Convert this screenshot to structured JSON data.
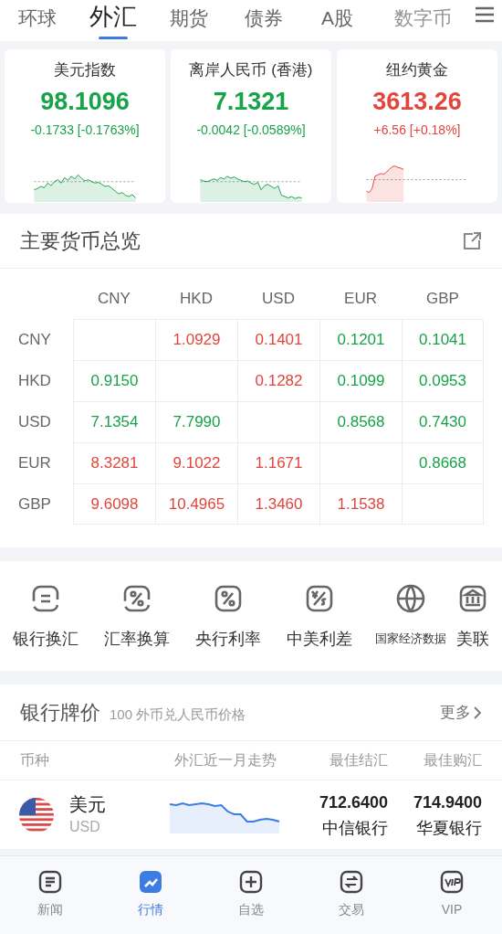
{
  "top_tabs": [
    {
      "label": "环球",
      "selected": false
    },
    {
      "label": "外汇",
      "selected": true
    },
    {
      "label": "期货",
      "selected": false
    },
    {
      "label": "债券",
      "selected": false
    },
    {
      "label": "A股",
      "selected": false
    },
    {
      "label": "数字币",
      "selected": false
    }
  ],
  "quote_cards": [
    {
      "name": "美元指数",
      "price": "98.1096",
      "change": "-0.1733 [-0.1763%]",
      "color": "#17a34a"
    },
    {
      "name": "离岸人民币 (香港)",
      "price": "7.1321",
      "change": "-0.0042 [-0.0589%]",
      "color": "#17a34a"
    },
    {
      "name": "纽约黄金",
      "price": "3613.26",
      "change": "+6.56 [+0.18%]",
      "color": "#e2453c"
    }
  ],
  "overview": {
    "title": "主要货币总览",
    "columns": [
      "CNY",
      "HKD",
      "USD",
      "EUR",
      "GBP"
    ],
    "rows": [
      {
        "label": "CNY",
        "cells": [
          null,
          {
            "value": "1.0929",
            "color": "#e2453c"
          },
          {
            "value": "0.1401",
            "color": "#e2453c"
          },
          {
            "value": "0.1201",
            "color": "#17a34a"
          },
          {
            "value": "0.1041",
            "color": "#17a34a"
          }
        ]
      },
      {
        "label": "HKD",
        "cells": [
          {
            "value": "0.9150",
            "color": "#17a34a"
          },
          null,
          {
            "value": "0.1282",
            "color": "#e2453c"
          },
          {
            "value": "0.1099",
            "color": "#17a34a"
          },
          {
            "value": "0.0953",
            "color": "#17a34a"
          }
        ]
      },
      {
        "label": "USD",
        "cells": [
          {
            "value": "7.1354",
            "color": "#17a34a"
          },
          {
            "value": "7.7990",
            "color": "#17a34a"
          },
          null,
          {
            "value": "0.8568",
            "color": "#17a34a"
          },
          {
            "value": "0.7430",
            "color": "#17a34a"
          }
        ]
      },
      {
        "label": "EUR",
        "cells": [
          {
            "value": "8.3281",
            "color": "#e2453c"
          },
          {
            "value": "9.1022",
            "color": "#e2453c"
          },
          {
            "value": "1.1671",
            "color": "#e2453c"
          },
          null,
          {
            "value": "0.8668",
            "color": "#17a34a"
          }
        ]
      },
      {
        "label": "GBP",
        "cells": [
          {
            "value": "9.6098",
            "color": "#e2453c"
          },
          {
            "value": "10.4965",
            "color": "#e2453c"
          },
          {
            "value": "1.3460",
            "color": "#e2453c"
          },
          {
            "value": "1.1538",
            "color": "#e2453c"
          },
          null
        ]
      }
    ]
  },
  "shortcuts": [
    {
      "label": "银行换汇",
      "kind": "exchange"
    },
    {
      "label": "汇率换算",
      "kind": "percent-cycle"
    },
    {
      "label": "央行利率",
      "kind": "percent"
    },
    {
      "label": "中美利差",
      "kind": "yen-dollar"
    },
    {
      "label": "国家经济数据",
      "kind": "globe"
    },
    {
      "label": "美联",
      "kind": "bank"
    }
  ],
  "bank_prices": {
    "title": "银行牌价",
    "subtitle": "100 外币兑人民币价格",
    "more": "更多",
    "columns": [
      "币种",
      "外汇近一月走势",
      "最佳结汇",
      "最佳购汇"
    ],
    "rows": [
      {
        "name": "美元",
        "code": "USD",
        "best_sell": "712.6400",
        "sell_bank": "中信银行",
        "best_buy": "714.9400",
        "buy_bank": "华夏银行"
      }
    ]
  },
  "bottom_nav": [
    {
      "label": "新闻",
      "kind": "news",
      "selected": false
    },
    {
      "label": "行情",
      "kind": "chart",
      "selected": true
    },
    {
      "label": "自选",
      "kind": "plus",
      "selected": false
    },
    {
      "label": "交易",
      "kind": "swap",
      "selected": false
    },
    {
      "label": "VIP",
      "kind": "vip",
      "selected": false
    }
  ]
}
